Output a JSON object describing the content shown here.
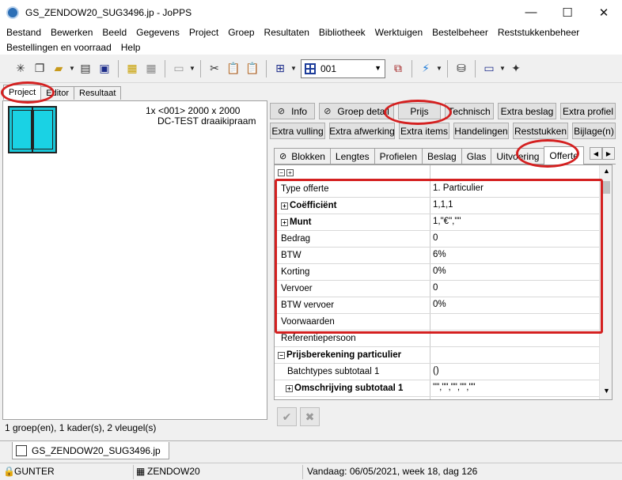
{
  "window": {
    "title": "GS_ZENDOW20_SUG3496.jp - JoPPS",
    "min": "—",
    "max": "☐",
    "close": "✕"
  },
  "menu": {
    "row1": [
      "Bestand",
      "Bewerken",
      "Beeld",
      "Gegevens",
      "Project",
      "Groep",
      "Resultaten",
      "Bibliotheek",
      "Werktuigen",
      "Bestelbeheer",
      "Reststukkenbeheer"
    ],
    "row2": [
      "Bestellingen en voorraad",
      "Help"
    ]
  },
  "toolbar": {
    "combo_value": "001"
  },
  "left_tabs": [
    "Project",
    "Editor",
    "Resultaat"
  ],
  "project": {
    "line1": "1x <001> 2000 x 2000",
    "line2": "DC-TEST draaikipraam"
  },
  "left_status": "1 groep(en), 1 kader(s), 2 vleugel(s)",
  "buttons": {
    "row1": [
      "Info",
      "Groep detail",
      "Prijs",
      "Technisch",
      "Extra beslag",
      "Extra profiel"
    ],
    "row2": [
      "Extra vulling",
      "Extra afwerking",
      "Extra items",
      "Handelingen",
      "Reststukken",
      "Bijlage(n)"
    ]
  },
  "sub_tabs": [
    "Blokken",
    "Lengtes",
    "Profielen",
    "Beslag",
    "Glas",
    "Uitvoering",
    "Offerte"
  ],
  "grid": {
    "rows": [
      {
        "key": "Type offerte",
        "value": "1. Particulier"
      },
      {
        "key": "Coëfficiënt",
        "value": "1,1,1"
      },
      {
        "key": "Munt",
        "value": "1,\"€\",\"\""
      },
      {
        "key": "Bedrag",
        "value": "0"
      },
      {
        "key": "BTW",
        "value": "6%"
      },
      {
        "key": "Korting",
        "value": "0%"
      },
      {
        "key": "Vervoer",
        "value": "0"
      },
      {
        "key": "BTW vervoer",
        "value": "0%"
      },
      {
        "key": "Voorwaarden",
        "value": ""
      },
      {
        "key": "Referentiepersoon",
        "value": ""
      },
      {
        "key": "Prijsberekening particulier",
        "value": ""
      },
      {
        "key": "Batchtypes subtotaal 1",
        "value": "()"
      },
      {
        "key": "Omschrijving subtotaal 1",
        "value": "\"\",\"\",\"\",\"\",\"\""
      }
    ]
  },
  "doc_tab": "GS_ZENDOW20_SUG3496.jp",
  "status": {
    "user": "GUNTER",
    "db": "ZENDOW20",
    "date": "Vandaag: 06/05/2021, week 18, dag 126"
  },
  "colors": {
    "annotation": "#d42020",
    "thumb": "#19c6d8"
  }
}
